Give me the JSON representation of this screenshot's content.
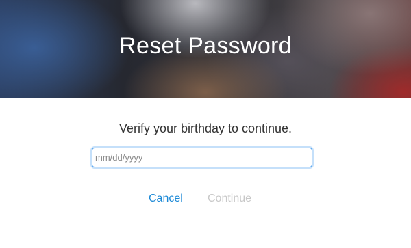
{
  "header": {
    "title": "Reset Password"
  },
  "form": {
    "prompt": "Verify your birthday to continue.",
    "birthday_placeholder": "mm/dd/yyyy",
    "birthday_value": ""
  },
  "actions": {
    "cancel_label": "Cancel",
    "continue_label": "Continue",
    "continue_enabled": false
  },
  "colors": {
    "link": "#1a88d6",
    "disabled": "#c8c8c8",
    "focus_ring": "#5aa7f0"
  }
}
